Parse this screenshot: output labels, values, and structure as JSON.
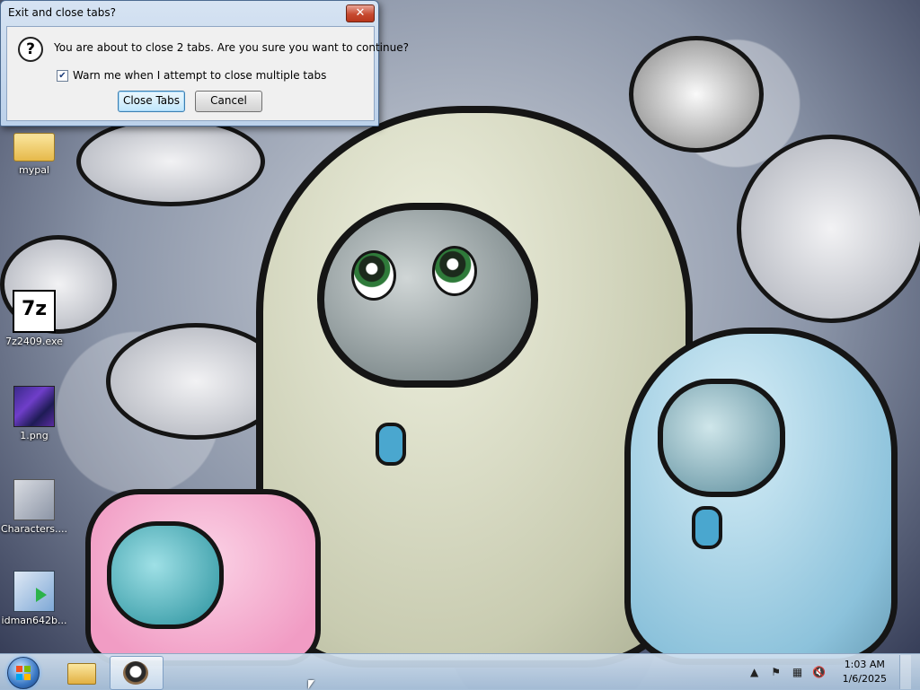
{
  "dialog": {
    "title": "Exit and close tabs?",
    "close_glyph": "✕",
    "question_glyph": "?",
    "message": "You are about to close 2 tabs. Are you sure you want to continue?",
    "checkbox_label": "Warn me when I attempt to close multiple tabs",
    "checkbox_checked": true,
    "checkbox_glyph": "✔",
    "close_tabs_button": "Close Tabs",
    "cancel_button": "Cancel"
  },
  "desktop": {
    "icons": [
      {
        "label": "mypal",
        "icon": "folder-icon"
      },
      {
        "label": "7z2409.exe",
        "icon": "7zip-icon",
        "glyph": "7z"
      },
      {
        "label": "1.png",
        "icon": "image-file-icon"
      },
      {
        "label": "Characters....",
        "icon": "image-file-icon"
      },
      {
        "label": "idman642b...",
        "icon": "installer-icon"
      }
    ]
  },
  "taskbar": {
    "tray": {
      "up_glyph": "▲",
      "flag_glyph": "⚑",
      "network_glyph": "▦",
      "volume_glyph": "🔇"
    },
    "clock": {
      "time": "1:03 AM",
      "date": "1/6/2025"
    }
  }
}
